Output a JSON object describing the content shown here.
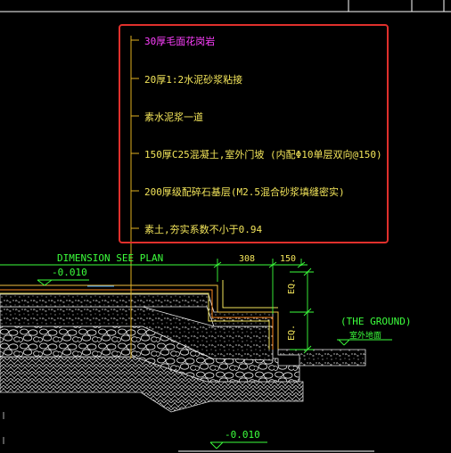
{
  "callout": {
    "notes": [
      "30厚毛面花岗岩",
      "20厚1:2水泥砂浆粘接",
      "素水泥浆一道",
      "150厚C25混凝土,室外门坡 (内配Φ10单层双向@150)",
      "200厚级配碎石基层(M2.5混合砂浆填缝密实)",
      "素土,夯实系数不小于0.94"
    ]
  },
  "labels": {
    "dimension_note": "DIMENSION SEE PLAN",
    "level_left": "-0.010",
    "level_bottom": "-0.010",
    "dim_308": "308",
    "dim_150": "150",
    "eq_upper": "EQ.",
    "eq_lower": "EQ.",
    "ground": "(THE GROUND)",
    "ground_cn": "室外地面"
  },
  "colors": {
    "background": "#000000",
    "frame": "#e0302c",
    "leader": "#e0b020",
    "note_text": "#f2e45a",
    "first_note": "#ff40ff",
    "dimension": "#3cff3c",
    "gravel": "#e8e8e8",
    "hatch": "#d8d8d8"
  }
}
